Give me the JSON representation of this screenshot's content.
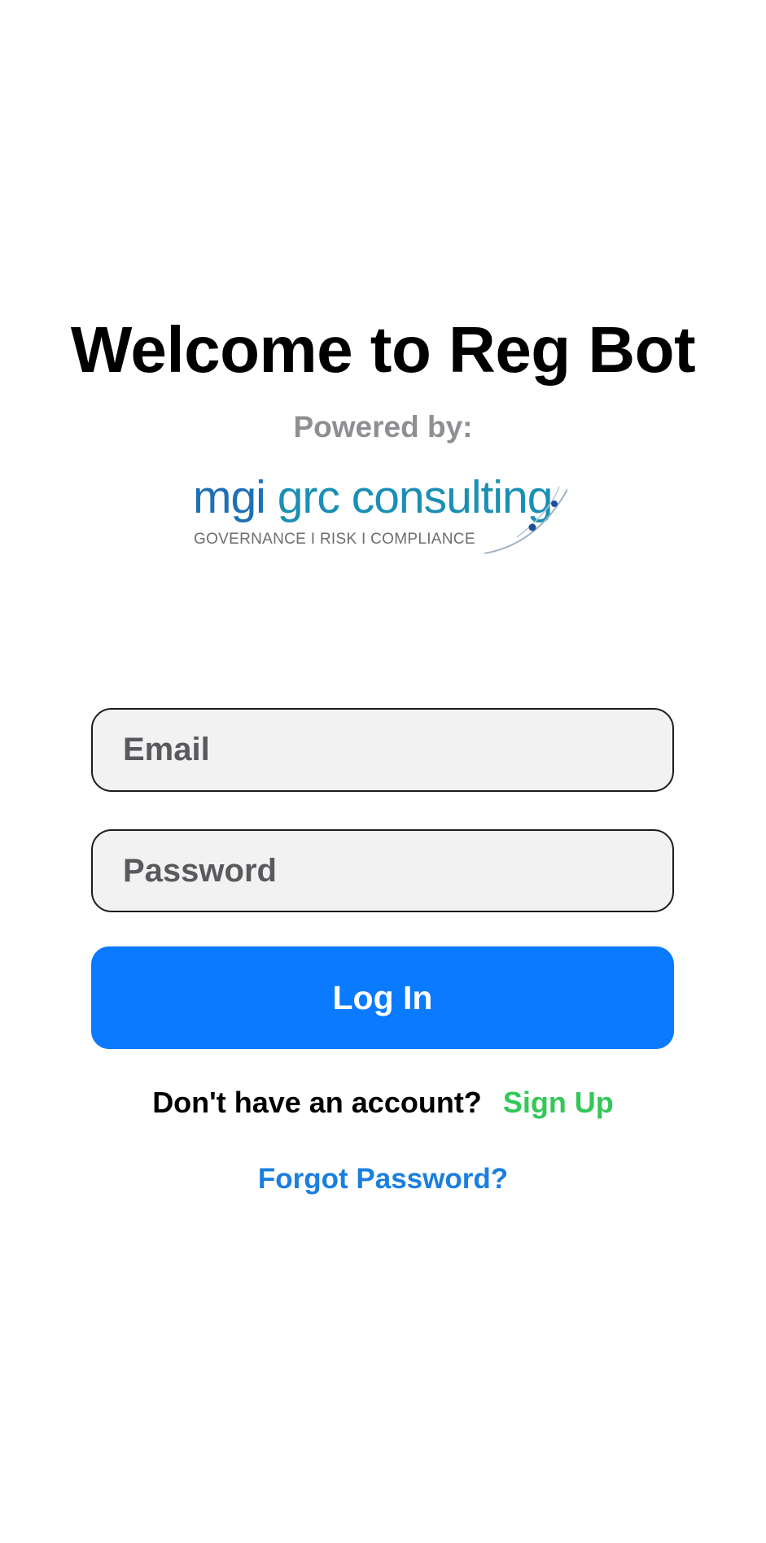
{
  "header": {
    "title": "Welcome to Reg Bot",
    "powered_by": "Powered by:"
  },
  "logo": {
    "wordmark_part1": "mgi",
    "wordmark_part2": "grc consulting",
    "tagline": "GOVERNANCE I RISK I COMPLIANCE",
    "colors": {
      "primary": "#1f6fb5",
      "secondary": "#1b8fb3",
      "tagline": "#6d6e71"
    }
  },
  "form": {
    "email": {
      "placeholder": "Email",
      "value": ""
    },
    "password": {
      "placeholder": "Password",
      "value": ""
    },
    "login_label": "Log In"
  },
  "footer": {
    "signup_prompt": "Don't have an account?",
    "signup_label": "Sign Up",
    "forgot_label": "Forgot Password?"
  },
  "colors": {
    "accent": "#0a7aff",
    "signup": "#34c759",
    "link": "#1a7fe0",
    "muted": "#8e8e93",
    "field_bg": "#f2f2f2"
  }
}
